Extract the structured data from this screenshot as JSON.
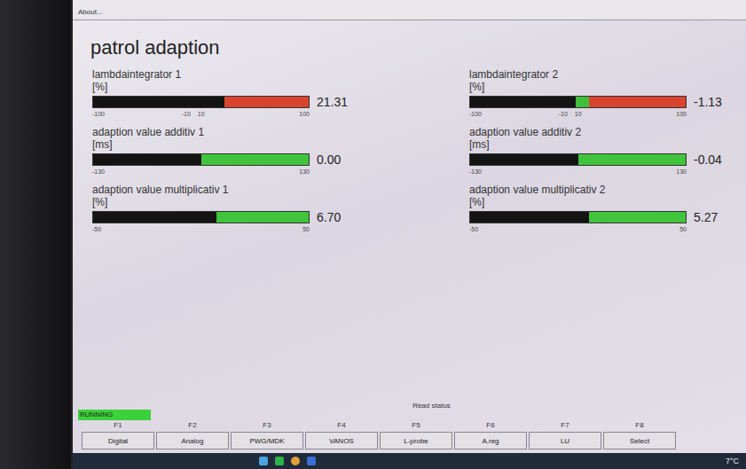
{
  "menu": {
    "about": "About..."
  },
  "title": "patrol adaption",
  "meters": [
    {
      "label": "lambdaintegrator 1",
      "unit": "[%]",
      "value": "21.31",
      "level": 0.61,
      "kind": "lambda",
      "scale": [
        "-100",
        "-10",
        "10",
        "100"
      ]
    },
    {
      "label": "adaption value additiv 1",
      "unit": "[ms]",
      "value": "0.00",
      "level": 0.5,
      "kind": "adaption",
      "scale": [
        "-130",
        "130"
      ]
    },
    {
      "label": "adaption value multiplicativ 1",
      "unit": "[%]",
      "value": "6.70",
      "level": 0.57,
      "kind": "adaption",
      "scale": [
        "-50",
        "50"
      ]
    },
    {
      "label": "lambdaintegrator 2",
      "unit": "[%]",
      "value": "-1.13",
      "level": 0.49,
      "kind": "lambda",
      "scale": [
        "-100",
        "-10",
        "10",
        "100"
      ]
    },
    {
      "label": "adaption value additiv 2",
      "unit": "[ms]",
      "value": "-0.04",
      "level": 0.5,
      "kind": "adaption",
      "scale": [
        "-130",
        "130"
      ]
    },
    {
      "label": "adaption value multiplicativ 2",
      "unit": "[%]",
      "value": "5.27",
      "level": 0.55,
      "kind": "adaption",
      "scale": [
        "-50",
        "50"
      ]
    }
  ],
  "status": {
    "label": "Read status",
    "state": "RUNNING"
  },
  "function_keys": [
    {
      "key": "F1",
      "label": "Digital"
    },
    {
      "key": "F2",
      "label": "Analog"
    },
    {
      "key": "F3",
      "label": "PWG/MDK"
    },
    {
      "key": "F4",
      "label": "VANOS"
    },
    {
      "key": "F5",
      "label": "L-probe"
    },
    {
      "key": "F6",
      "label": "A.reg"
    },
    {
      "key": "F7",
      "label": "LU"
    },
    {
      "key": "F8",
      "label": "Select"
    }
  ],
  "taskbar": {
    "temperature": "7°C"
  }
}
